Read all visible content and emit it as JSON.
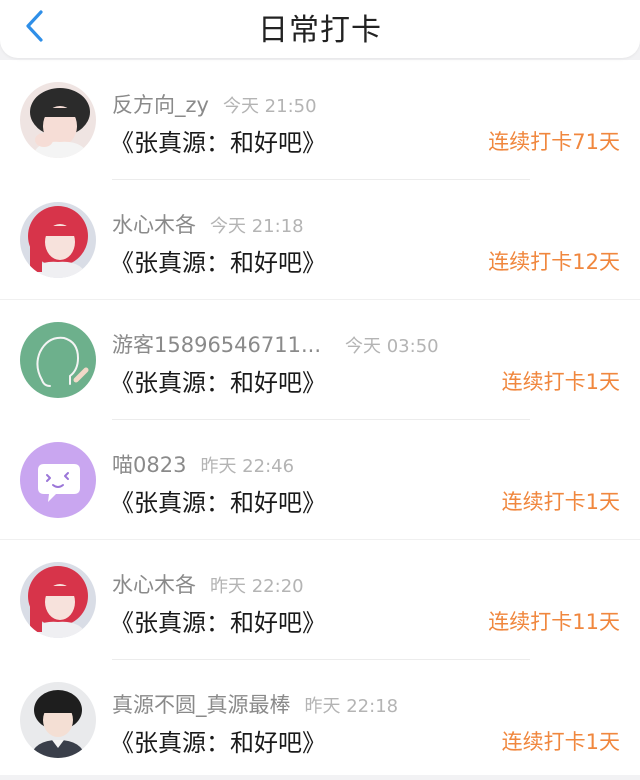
{
  "header": {
    "title": "日常打卡"
  },
  "items": [
    {
      "name": "反方向_zy",
      "time": "今天 21:50",
      "song": "《张真源：和好吧》",
      "streak": "连续打卡71天"
    },
    {
      "name": "水心木各",
      "time": "今天 21:18",
      "song": "《张真源：和好吧》",
      "streak": "连续打卡12天"
    },
    {
      "name": "游客15896546711...",
      "time": "今天 03:50",
      "song": "《张真源：和好吧》",
      "streak": "连续打卡1天"
    },
    {
      "name": "喵0823",
      "time": "昨天 22:46",
      "song": "《张真源：和好吧》",
      "streak": "连续打卡1天"
    },
    {
      "name": "水心木各",
      "time": "昨天 22:20",
      "song": "《张真源：和好吧》",
      "streak": "连续打卡11天"
    },
    {
      "name": "真源不圆_真源最棒",
      "time": "昨天 22:18",
      "song": "《张真源：和好吧》",
      "streak": "连续打卡1天"
    }
  ],
  "colors": {
    "accent_orange": "#f0873e",
    "back_blue": "#2f8fe8",
    "guest_avatar_bg": "#6db08c",
    "cat_avatar_bg": "#c9a6f0"
  },
  "icons": [
    "chevron-left-icon"
  ]
}
